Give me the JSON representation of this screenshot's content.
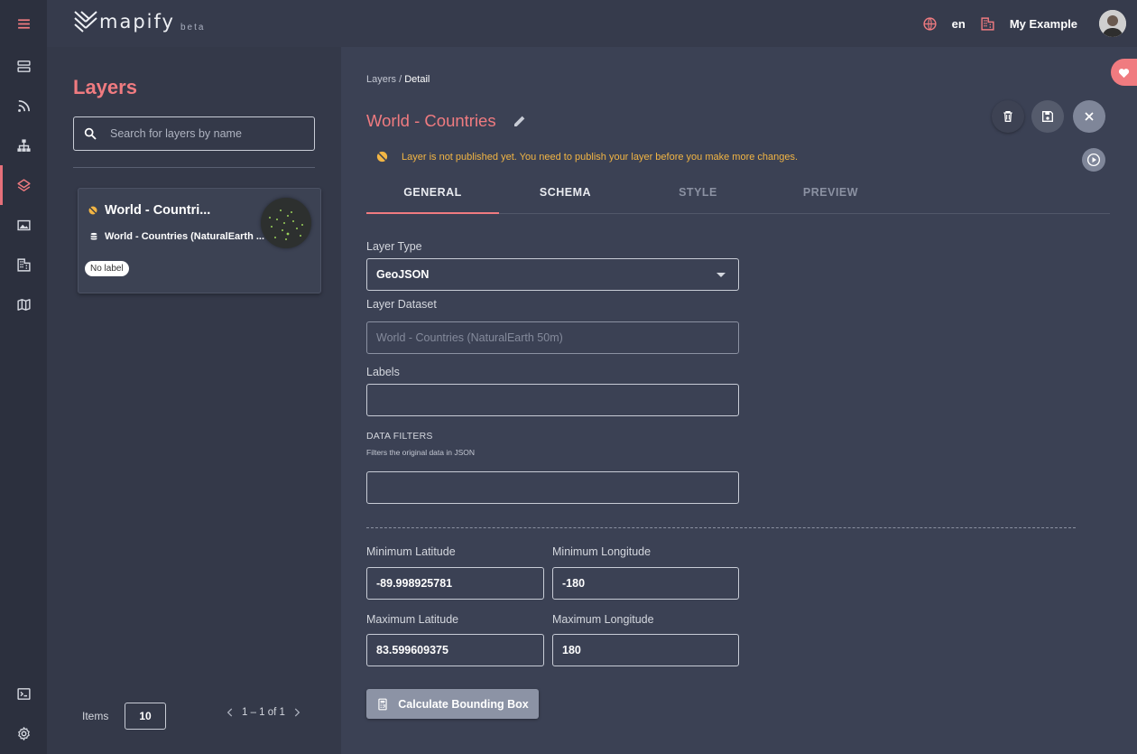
{
  "app": {
    "name": "mapify",
    "beta": "beta",
    "language": "en",
    "organization": "My Example"
  },
  "layers_panel": {
    "title": "Layers",
    "search_placeholder": "Search for layers by name",
    "cards": [
      {
        "title": "World - Countri...",
        "dataset": "World - Countries (NaturalEarth ...",
        "label_chip": "No label"
      }
    ],
    "pagination": {
      "items_label": "Items",
      "page_size": "10",
      "range": "1 – 1 of 1"
    }
  },
  "detail": {
    "breadcrumb_root": "Layers",
    "breadcrumb_sep": "/",
    "breadcrumb_current": "Detail",
    "title": "World - Countries",
    "warning": "Layer is not published yet. You need to publish your layer before you make more changes.",
    "tabs": [
      {
        "label": "GENERAL",
        "state": "active"
      },
      {
        "label": "SCHEMA",
        "state": "enabled"
      },
      {
        "label": "STYLE",
        "state": "disabled"
      },
      {
        "label": "PREVIEW",
        "state": "disabled"
      }
    ],
    "form": {
      "layer_type_label": "Layer Type",
      "layer_type_value": "GeoJSON",
      "layer_dataset_label": "Layer Dataset",
      "layer_dataset_value": "World - Countries (NaturalEarth 50m)",
      "labels_label": "Labels",
      "labels_value": "",
      "data_filters_title": "DATA FILTERS",
      "data_filters_subtitle": "Filters the original data in JSON",
      "data_filters_value": "",
      "min_lat_label": "Minimum Latitude",
      "min_lat_value": "-89.998925781",
      "min_lon_label": "Minimum Longitude",
      "min_lon_value": "-180",
      "max_lat_label": "Maximum Latitude",
      "max_lat_value": "83.599609375",
      "max_lon_label": "Maximum Longitude",
      "max_lon_value": "180",
      "calc_button": "Calculate Bounding Box"
    }
  },
  "colors": {
    "accent": "#f07b80",
    "warning": "#f2b544",
    "rail_bg": "#2c303e",
    "panel_bg": "#343949",
    "main_bg": "#3b4154"
  },
  "icons": {
    "rail": [
      "menu-icon",
      "storage-icon",
      "rss-feed-icon",
      "hierarchy-icon",
      "layers-icon",
      "image-icon",
      "building-icon",
      "map-icon",
      "terminal-icon",
      "settings-icon"
    ],
    "topbar": [
      "globe-icon",
      "building-icon",
      "avatar"
    ],
    "actions": [
      "trash-icon",
      "save-icon",
      "close-icon",
      "play-icon",
      "pencil-icon",
      "heart-icon"
    ]
  }
}
